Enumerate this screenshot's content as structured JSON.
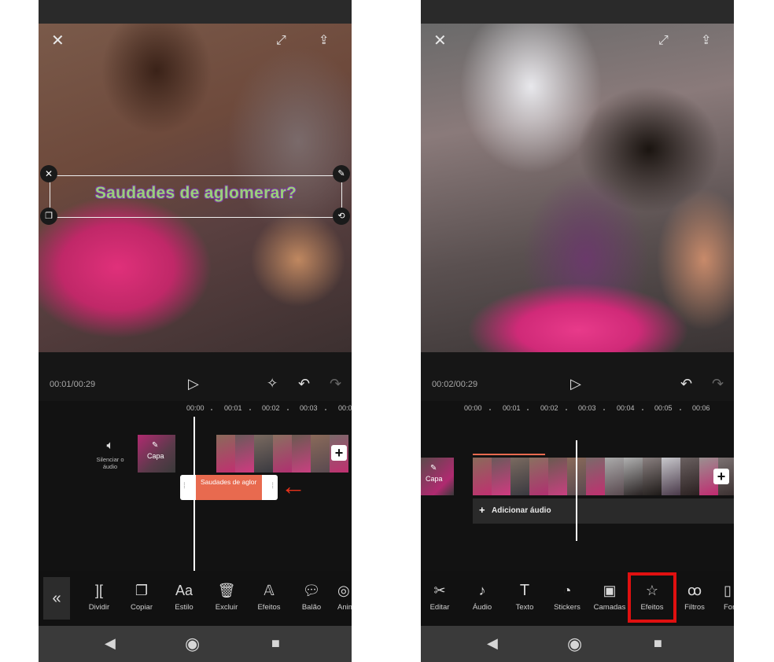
{
  "left_screen": {
    "title_text": "Saudades de aglomerar?",
    "timecode": "00:01/00:29",
    "ruler": [
      "00:00",
      "00:01",
      "00:02",
      "00:03",
      "00:0"
    ],
    "mute_label": "Silenciar o áudio",
    "cover_label": "Capa",
    "text_clip_label": "Saudades de aglor",
    "arrow": "←",
    "tools": [
      {
        "icon": "split-icon",
        "label": "Dividir"
      },
      {
        "icon": "copy-icon",
        "label": "Copiar"
      },
      {
        "icon": "text-style-icon",
        "label": "Estilo"
      },
      {
        "icon": "trash-icon",
        "label": "Excluir"
      },
      {
        "icon": "effects-text-icon",
        "label": "Efeitos"
      },
      {
        "icon": "speech-bubble-icon",
        "label": "Balão"
      },
      {
        "icon": "animation-icon",
        "label": "Anim"
      }
    ]
  },
  "right_screen": {
    "timecode": "00:02/00:29",
    "ruler": [
      "00:00",
      "00:01",
      "00:02",
      "00:03",
      "00:04",
      "00:05",
      "00:06"
    ],
    "cover_label": "Capa",
    "add_audio_label": "Adicionar áudio",
    "tools": [
      {
        "icon": "scissors-icon",
        "label": "Editar"
      },
      {
        "icon": "music-note-icon",
        "label": "Áudio"
      },
      {
        "icon": "text-icon",
        "label": "Texto"
      },
      {
        "icon": "sticker-icon",
        "label": "Stickers"
      },
      {
        "icon": "layers-icon",
        "label": "Camadas"
      },
      {
        "icon": "star-effects-icon",
        "label": "Efeitos"
      },
      {
        "icon": "filters-icon",
        "label": "Filtros"
      },
      {
        "icon": "format-icon",
        "label": "For"
      }
    ],
    "highlight_color": "#e01010"
  },
  "colors": {
    "accent_orange": "#e86a4f",
    "arrow_red": "#e8321b",
    "timeline_bg": "#121212"
  }
}
